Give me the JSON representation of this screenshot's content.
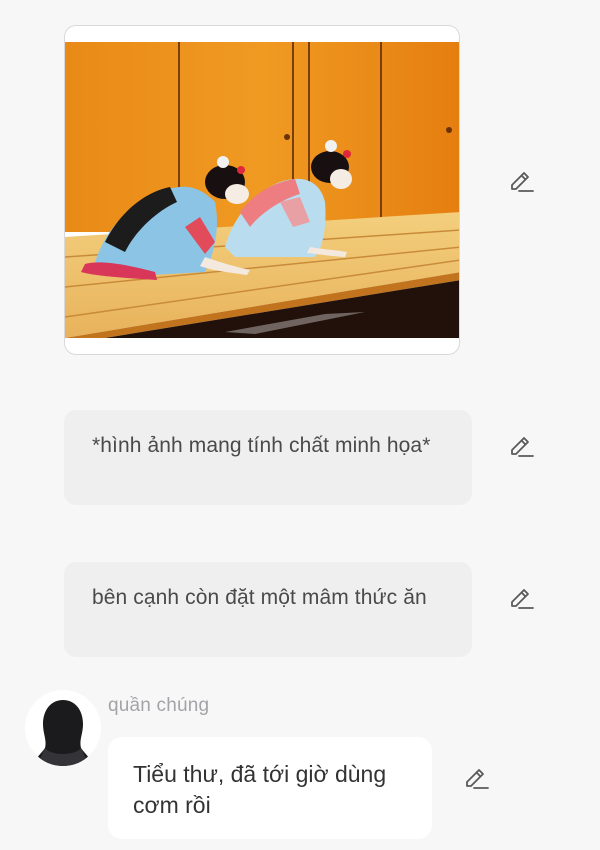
{
  "story": {
    "illustration": {
      "icon": "photo"
    },
    "narrations": [
      {
        "text": "*hình ảnh mang tính chất minh họa*"
      },
      {
        "text": "bên cạnh còn đặt một mâm thức ăn"
      }
    ],
    "dialogue": {
      "speaker": "quần chúng",
      "text": "Tiểu thư, đã tới giờ dùng cơm rồi"
    }
  },
  "icons": {
    "edit": "pencil-icon"
  },
  "colors": {
    "background": "#f7f7f8",
    "narration_bg": "#efeff0",
    "bubble_bg": "#ffffff",
    "speaker_name": "#a4a4a8",
    "icon": "#5a5a5a"
  }
}
